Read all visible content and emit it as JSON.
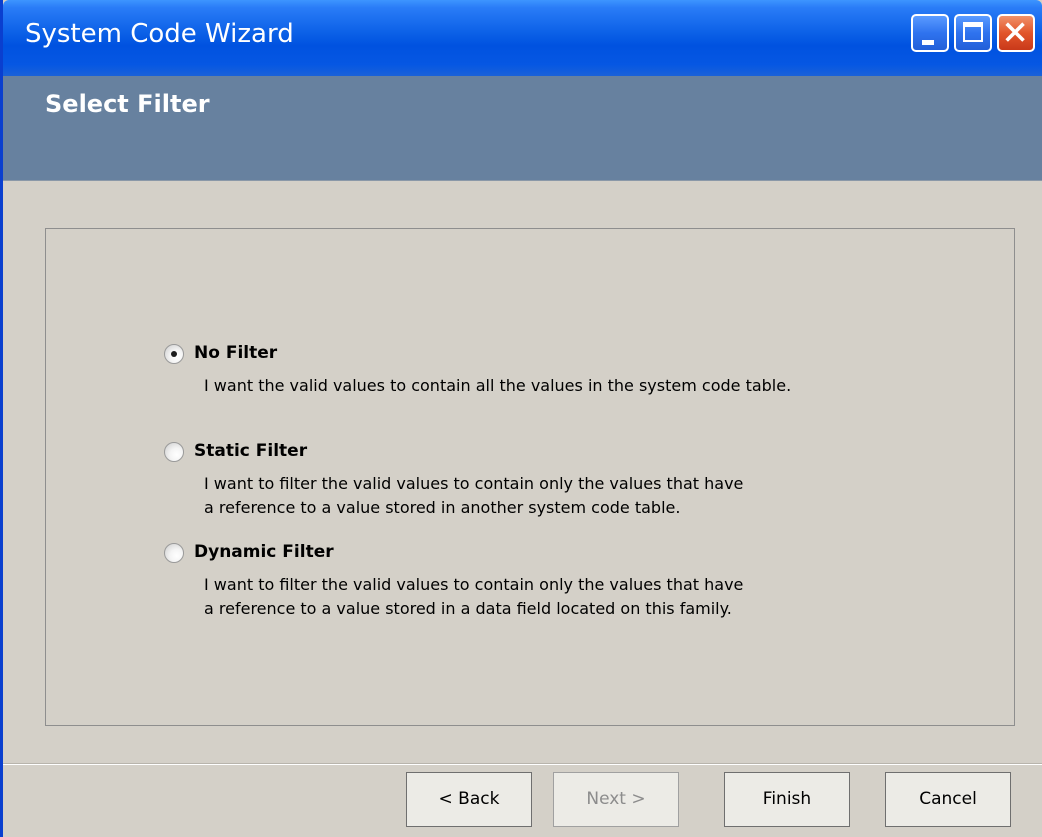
{
  "window": {
    "title": "System Code Wizard"
  },
  "header": {
    "title": "Select Filter"
  },
  "options": [
    {
      "label": "No Filter",
      "selected": true,
      "description_lines": [
        "I want the valid values to contain all the values in the system code table."
      ]
    },
    {
      "label": "Static Filter",
      "selected": false,
      "description_lines": [
        "I want to filter the valid values to contain only the values that have",
        "a reference to a value stored in another system code table."
      ]
    },
    {
      "label": "Dynamic Filter",
      "selected": false,
      "description_lines": [
        "I want to filter the valid values to contain only the values that have",
        "a reference to a value stored in a data field located on this family."
      ]
    }
  ],
  "buttons": {
    "back": "< Back",
    "next": "Next >",
    "finish": "Finish",
    "cancel": "Cancel"
  },
  "colors": {
    "titlebar": "#0a5fe6",
    "header_band": "#67819f",
    "dialog_bg": "#d4d0c8",
    "close_button": "#e2552a"
  },
  "icons": {
    "minimize": "minimize-icon",
    "maximize": "maximize-icon",
    "close": "close-icon"
  }
}
